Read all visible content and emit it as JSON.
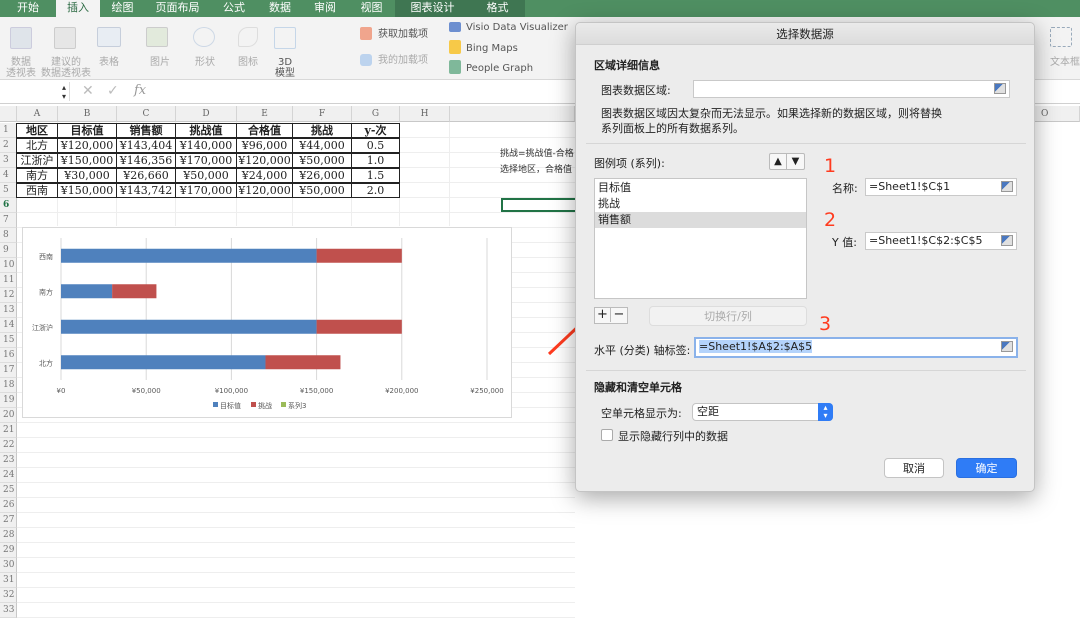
{
  "ribbon_tabs": [
    {
      "label": "开始"
    },
    {
      "label": "插入",
      "active": true
    },
    {
      "label": "绘图"
    },
    {
      "label": "页面布局"
    },
    {
      "label": "公式"
    },
    {
      "label": "数据"
    },
    {
      "label": "审阅"
    },
    {
      "label": "视图"
    },
    {
      "label": "图表设计"
    },
    {
      "label": "格式"
    }
  ],
  "ribbon": {
    "pivot": "数据\n透视表",
    "rec_pivot": "建议的\n数据透视表",
    "table": "表格",
    "picture": "图片",
    "shapes": "形状",
    "icons": "图标",
    "model3d": "3D\n模型",
    "get_addins": "获取加载项",
    "my_addins": "我的加载项",
    "visio": "Visio Data Visualizer",
    "bing": "Bing Maps",
    "people": "People Graph",
    "textbox": "文本框"
  },
  "formula_bar": {
    "fx": "fx",
    "value": ""
  },
  "columns": [
    "A",
    "B",
    "C",
    "D",
    "E",
    "F",
    "G",
    "H",
    "O"
  ],
  "rows": [
    "1",
    "2",
    "3",
    "4",
    "5",
    "6",
    "7",
    "8",
    "9",
    "10",
    "11",
    "12",
    "13",
    "14",
    "15",
    "16",
    "17",
    "18",
    "19",
    "20",
    "21",
    "22",
    "23",
    "24",
    "25",
    "26",
    "27",
    "28",
    "29",
    "30",
    "31",
    "32",
    "33"
  ],
  "table": {
    "headers": [
      "地区",
      "目标值",
      "销售额",
      "挑战值",
      "合格值",
      "挑战",
      "y-次"
    ],
    "rows": [
      [
        "北方",
        "¥120,000",
        "¥143,404",
        "¥140,000",
        "¥96,000",
        "¥44,000",
        "0.5"
      ],
      [
        "江浙沪",
        "¥150,000",
        "¥146,356",
        "¥170,000",
        "¥120,000",
        "¥50,000",
        "1.0"
      ],
      [
        "南方",
        "¥30,000",
        "¥26,660",
        "¥50,000",
        "¥24,000",
        "¥26,000",
        "1.5"
      ],
      [
        "西南",
        "¥150,000",
        "¥143,742",
        "¥170,000",
        "¥120,000",
        "¥50,000",
        "2.0"
      ]
    ]
  },
  "notes": [
    "挑战=挑战值-合格",
    "选择地区，合格值"
  ],
  "chart_data": {
    "type": "bar",
    "orientation": "horizontal",
    "stacked": true,
    "categories": [
      "北方",
      "江浙沪",
      "南方",
      "西南"
    ],
    "series": [
      {
        "name": "目标值",
        "values": [
          120000,
          150000,
          30000,
          150000
        ],
        "color": "#4f81bd"
      },
      {
        "name": "挑战",
        "values": [
          44000,
          50000,
          26000,
          50000
        ],
        "color": "#c0504d"
      },
      {
        "name": "系列3",
        "values": [],
        "color": "#9bbb59"
      }
    ],
    "xlim": [
      0,
      250000
    ],
    "xticks": [
      "¥0",
      "¥50,000",
      "¥100,000",
      "¥150,000",
      "¥200,000",
      "¥250,000"
    ],
    "grid": true,
    "legend": "bottom"
  },
  "dialog": {
    "title": "选择数据源",
    "section1": "区域详细信息",
    "range_label": "图表数据区域:",
    "range_value": "",
    "range_note": "图表数据区域因太复杂而无法显示。如果选择新的数据区域，则将替换\n系列面板上的所有数据系列。",
    "legend_label": "图例项 (系列):",
    "series_list": [
      "目标值",
      "挑战",
      "销售额"
    ],
    "selected_series": "销售额",
    "name_label": "名称:",
    "name_value": "=Sheet1!$C$1",
    "y_label": "Y 值:",
    "y_value": "=Sheet1!$C$2:$C$5",
    "switch_button": "切换行/列",
    "axis_label": "水平 (分类) 轴标签:",
    "axis_value": "=Sheet1!$A$2:$A$5",
    "section2": "隐藏和清空单元格",
    "empty_label": "空单元格显示为:",
    "empty_value": "空距",
    "show_hidden": "显示隐藏行列中的数据",
    "show_hidden_checked": false,
    "cancel": "取消",
    "ok": "确定",
    "annotations": [
      "1",
      "2",
      "3"
    ]
  }
}
